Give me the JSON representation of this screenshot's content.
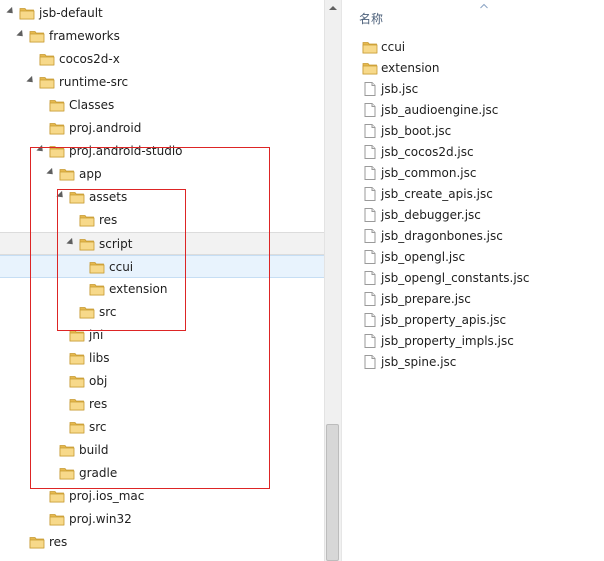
{
  "tree": {
    "rows": [
      {
        "label": "jsb-default",
        "expanded": true
      },
      {
        "label": "frameworks",
        "expanded": true
      },
      {
        "label": "cocos2d-x",
        "expanded": false
      },
      {
        "label": "runtime-src",
        "expanded": true
      },
      {
        "label": "Classes",
        "expanded": false
      },
      {
        "label": "proj.android",
        "expanded": false
      },
      {
        "label": "proj.android-studio",
        "expanded": true
      },
      {
        "label": "app",
        "expanded": true
      },
      {
        "label": "assets",
        "expanded": true
      },
      {
        "label": "res",
        "expanded": false
      },
      {
        "label": "script",
        "expanded": true
      },
      {
        "label": "ccui",
        "expanded": false,
        "selected": true
      },
      {
        "label": "extension",
        "expanded": false
      },
      {
        "label": "src",
        "expanded": false
      },
      {
        "label": "jni",
        "expanded": false
      },
      {
        "label": "libs",
        "expanded": false
      },
      {
        "label": "obj",
        "expanded": false
      },
      {
        "label": "res",
        "expanded": false
      },
      {
        "label": "src",
        "expanded": false
      },
      {
        "label": "build",
        "expanded": false
      },
      {
        "label": "gradle",
        "expanded": false
      },
      {
        "label": "proj.ios_mac",
        "expanded": false
      },
      {
        "label": "proj.win32",
        "expanded": false
      },
      {
        "label": "res",
        "expanded": false
      }
    ]
  },
  "file_list": {
    "column_header": "名称",
    "items": [
      {
        "name": "ccui",
        "type": "folder"
      },
      {
        "name": "extension",
        "type": "folder"
      },
      {
        "name": "jsb.jsc",
        "type": "file"
      },
      {
        "name": "jsb_audioengine.jsc",
        "type": "file"
      },
      {
        "name": "jsb_boot.jsc",
        "type": "file"
      },
      {
        "name": "jsb_cocos2d.jsc",
        "type": "file"
      },
      {
        "name": "jsb_common.jsc",
        "type": "file"
      },
      {
        "name": "jsb_create_apis.jsc",
        "type": "file"
      },
      {
        "name": "jsb_debugger.jsc",
        "type": "file"
      },
      {
        "name": "jsb_dragonbones.jsc",
        "type": "file"
      },
      {
        "name": "jsb_opengl.jsc",
        "type": "file"
      },
      {
        "name": "jsb_opengl_constants.jsc",
        "type": "file"
      },
      {
        "name": "jsb_prepare.jsc",
        "type": "file"
      },
      {
        "name": "jsb_property_apis.jsc",
        "type": "file"
      },
      {
        "name": "jsb_property_impls.jsc",
        "type": "file"
      },
      {
        "name": "jsb_spine.jsc",
        "type": "file"
      }
    ]
  },
  "colors": {
    "highlight_box": "#dd2525",
    "selection": "#e8f3fd",
    "folder_fill": "#f5d987"
  }
}
